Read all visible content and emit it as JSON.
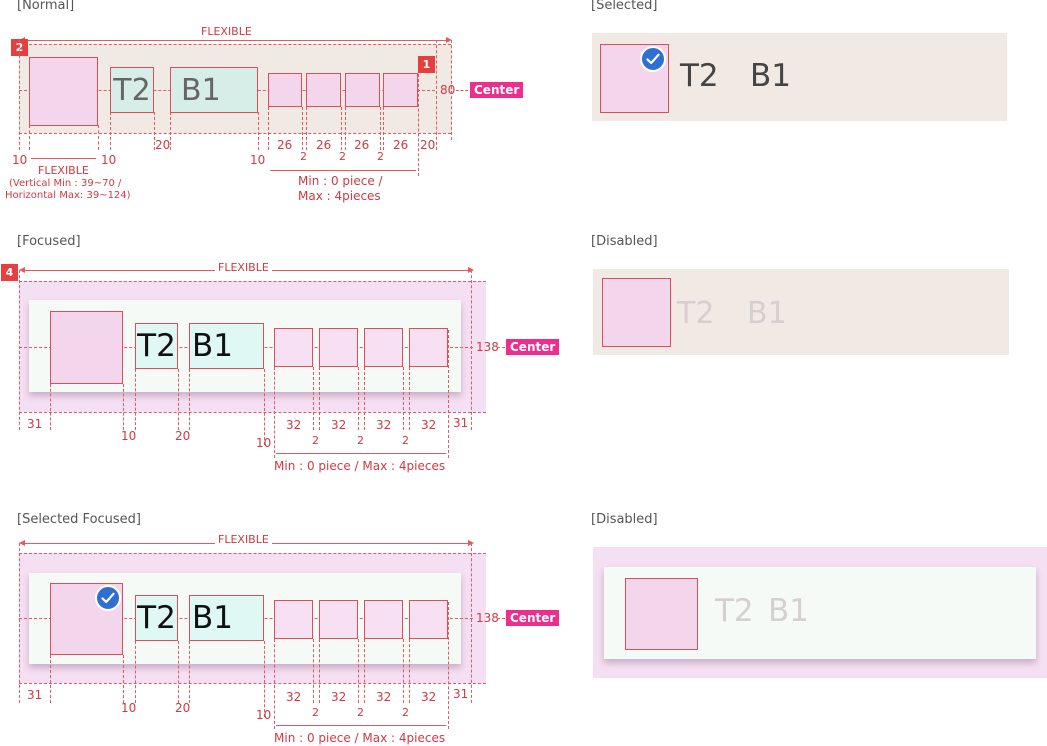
{
  "sections": {
    "normal": "[Normal]",
    "selected": "[Selected]",
    "focused": "[Focused]",
    "disabled_1": "[Disabled]",
    "selected_focused": "[Selected Focused]",
    "disabled_2": "[Disabled]"
  },
  "labels": {
    "t2": "T2",
    "b1": "B1",
    "flexible": "FLEXIBLE",
    "center": "Center",
    "badge_1": "1",
    "badge_2": "2",
    "badge_4": "4"
  },
  "normal_dims": {
    "height": "80",
    "w10a": "10",
    "w10b": "10",
    "w20": "20",
    "w10c": "10",
    "p1": "26",
    "g1": "2",
    "p2": "26",
    "g2": "2",
    "p3": "26",
    "g3": "2",
    "p4": "26",
    "w20b": "20",
    "thumb_flexible": "FLEXIBLE",
    "thumb_range_1": "(Vertical Min : 39~70 /",
    "thumb_range_2": "Horizontal Max: 39~124)",
    "pieces_1": "Min : 0 piece /",
    "pieces_2": "Max : 4pieces"
  },
  "focused_dims": {
    "height": "138",
    "w31a": "31",
    "w10a": "10",
    "w20": "20",
    "w10b": "10",
    "p1": "32",
    "g1": "2",
    "p2": "32",
    "g2": "2",
    "p3": "32",
    "g3": "2",
    "p4": "32",
    "w31b": "31",
    "pieces": "Min : 0 piece  /  Max : 4pieces"
  },
  "sel_focused_dims": {
    "height": "138",
    "w31a": "31",
    "w10a": "10",
    "w20": "20",
    "w10b": "10",
    "p1": "32",
    "g1": "2",
    "p2": "32",
    "g2": "2",
    "p3": "32",
    "g3": "2",
    "p4": "32",
    "w31b": "31",
    "pieces": "Min : 0 piece  /  Max : 4pieces"
  },
  "colors": {
    "annotation": "#e05a5f",
    "center_tag": "#ec2e8c",
    "badge": "#e53f3f",
    "check": "#2f6fd4",
    "normal_bg": "#f1e9e4",
    "focus_bg": "#f5dff2",
    "thumb": "#f3d6ec"
  },
  "icons": {
    "check": "check-circle-icon"
  }
}
